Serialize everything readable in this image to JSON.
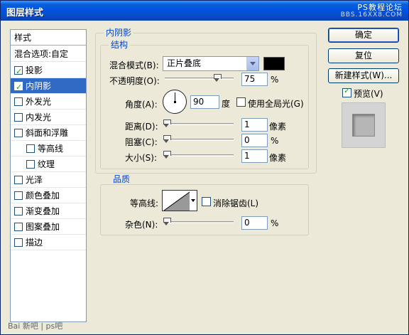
{
  "titlebar": {
    "title": "图层样式",
    "watermark_line1": "PS教程论坛",
    "watermark_line2": "BBS.16XX8.COM"
  },
  "left_list": {
    "header": "样式",
    "blend_options": "混合选项:自定",
    "items": [
      {
        "label": "投影",
        "checked": true
      },
      {
        "label": "内阴影",
        "checked": true
      },
      {
        "label": "外发光",
        "checked": false
      },
      {
        "label": "内发光",
        "checked": false
      },
      {
        "label": "斜面和浮雕",
        "checked": false
      },
      {
        "label": "等高线",
        "checked": false
      },
      {
        "label": "纹理",
        "checked": false
      },
      {
        "label": "光泽",
        "checked": false
      },
      {
        "label": "颜色叠加",
        "checked": false
      },
      {
        "label": "渐变叠加",
        "checked": false
      },
      {
        "label": "图案叠加",
        "checked": false
      },
      {
        "label": "描边",
        "checked": false
      }
    ]
  },
  "panel": {
    "title": "内阴影",
    "structure": {
      "title": "结构",
      "blend_mode_label": "混合模式(B):",
      "blend_mode_value": "正片叠底",
      "blend_color": "#000000",
      "opacity_label": "不透明度(O):",
      "opacity_value": "75",
      "opacity_unit": "%",
      "angle_label": "角度(A):",
      "angle_value": "90",
      "angle_unit": "度",
      "global_light_label": "使用全局光(G)",
      "global_light_checked": false,
      "distance_label": "距离(D):",
      "distance_value": "1",
      "distance_unit": "像素",
      "choke_label": "阻塞(C):",
      "choke_value": "0",
      "choke_unit": "%",
      "size_label": "大小(S):",
      "size_value": "1",
      "size_unit": "像素"
    },
    "quality": {
      "title": "品质",
      "contour_label": "等高线:",
      "anti_alias_label": "消除锯齿(L)",
      "anti_alias_checked": false,
      "noise_label": "杂色(N):",
      "noise_value": "0",
      "noise_unit": "%"
    }
  },
  "buttons": {
    "ok": "确定",
    "reset": "复位",
    "new_style": "新建样式(W)...",
    "preview_label": "预览(V)",
    "preview_checked": true
  },
  "footer": {
    "watermark": "Bai 新吧 | ps吧"
  }
}
